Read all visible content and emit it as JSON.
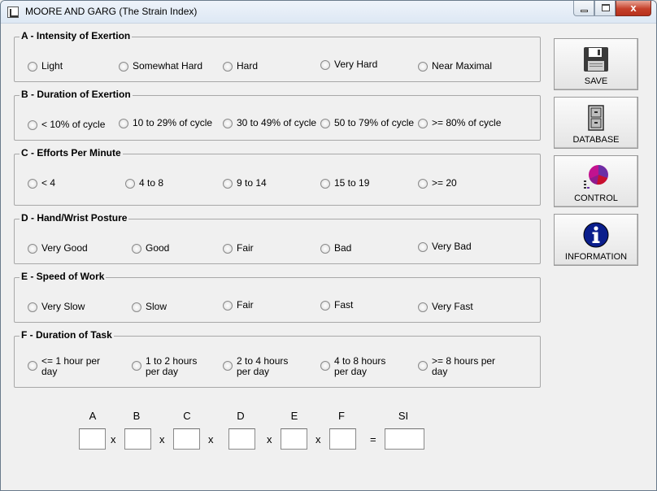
{
  "window": {
    "title": "MOORE AND GARG (The Strain Index)",
    "min_glyph": "",
    "max_glyph": "",
    "close_glyph": "x"
  },
  "groups": [
    {
      "title": "A - Intensity of Exertion",
      "options": [
        "Light",
        "Somewhat Hard",
        "Hard",
        "Very Hard",
        "Near Maximal"
      ]
    },
    {
      "title": "B - Duration of Exertion",
      "options": [
        "< 10% of cycle",
        "10 to 29% of cycle",
        "30 to 49% of cycle",
        "50 to 79% of cycle",
        ">= 80% of cycle"
      ]
    },
    {
      "title": "C - Efforts Per Minute",
      "options": [
        "< 4",
        "4 to 8",
        "9 to 14",
        "15 to 19",
        ">= 20"
      ]
    },
    {
      "title": "D - Hand/Wrist Posture",
      "options": [
        "Very Good",
        "Good",
        "Fair",
        "Bad",
        "Very Bad"
      ]
    },
    {
      "title": "E - Speed of Work",
      "options": [
        "Very Slow",
        "Slow",
        "Fair",
        "Fast",
        "Very Fast"
      ]
    },
    {
      "title": "F - Duration of Task",
      "options": [
        "<= 1 hour per day",
        "1 to 2 hours per day",
        "2 to 4 hours per day",
        "4 to 8 hours per day",
        ">= 8 hours per day"
      ]
    }
  ],
  "side_buttons": {
    "save": "SAVE",
    "database": "DATABASE",
    "control": "CONTROL",
    "information": "INFORMATION"
  },
  "icons": {
    "save": "floppy-disk-icon",
    "database": "file-cabinet-icon",
    "control": "pie-chart-icon",
    "information": "info-icon",
    "info_glyph": "i"
  },
  "calc": {
    "labels": [
      "A",
      "B",
      "C",
      "D",
      "E",
      "F",
      "SI"
    ],
    "operators": [
      "x",
      "x",
      "x",
      "x",
      "x",
      "="
    ],
    "values": [
      "",
      "",
      "",
      "",
      "",
      "",
      ""
    ]
  },
  "colors": {
    "info_blue": "#0a1e8c",
    "pie_magenta": "#c2128f",
    "pie_purple": "#6b2fa6",
    "pie_red": "#c8102e"
  }
}
